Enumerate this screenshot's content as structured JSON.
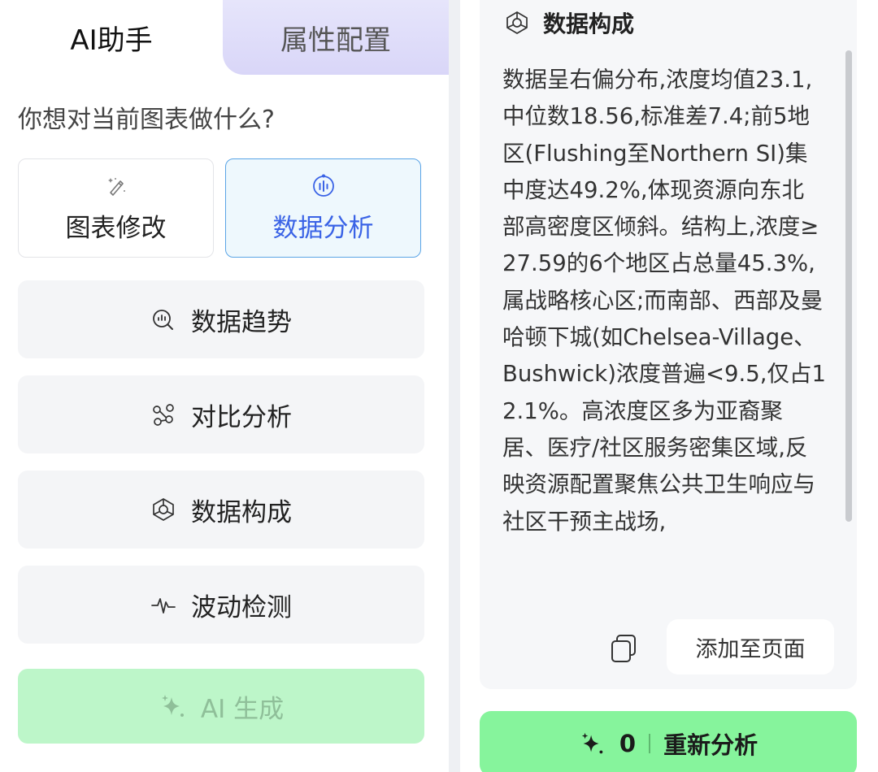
{
  "tabs": {
    "ai_assistant": "AI助手",
    "property_config": "属性配置"
  },
  "question": "你想对当前图表做什么?",
  "modes": {
    "chart_edit": "图表修改",
    "data_analysis": "数据分析"
  },
  "functions": {
    "trend": "数据趋势",
    "compare": "对比分析",
    "composition": "数据构成",
    "fluctuation": "波动检测"
  },
  "ai_generate": "AI 生成",
  "result_panel": {
    "title": "数据构成",
    "text": "数据呈右偏分布,浓度均值23.1,中位数18.56,标准差7.4;前5地区(Flushing至Northern SI)集中度达49.2%,体现资源向东北部高密度区倾斜。结构上,浓度≥27.59的6个地区占总量45.3%,属战略核心区;而南部、西部及曼哈顿下城(如Chelsea-Village、Bushwick)浓度普遍<9.5,仅占12.1%。高浓度区多为亚裔聚居、医疗/社区服务密集区域,反映资源配置聚焦公共卫生响应与社区干预主战场,",
    "add_to_page": "添加至页面"
  },
  "reanalyze": {
    "count": "0",
    "label": "重新分析"
  },
  "colors": {
    "accent_blue": "#3a63e6",
    "active_card_border": "#5aa4e6",
    "ai_generate_bg": "#bdf6c9",
    "reanalyze_bg": "#86f49c",
    "tab_inactive_bg": "#dcd9f8"
  },
  "icons": {
    "chart_edit": "magic-pen-icon",
    "data_analysis": "analysis-circle-icon",
    "trend": "trend-search-icon",
    "compare": "compare-nodes-icon",
    "composition": "composition-cube-icon",
    "fluctuation": "pulse-wave-icon",
    "sparkle": "sparkle-icon",
    "copy": "copy-icon"
  }
}
